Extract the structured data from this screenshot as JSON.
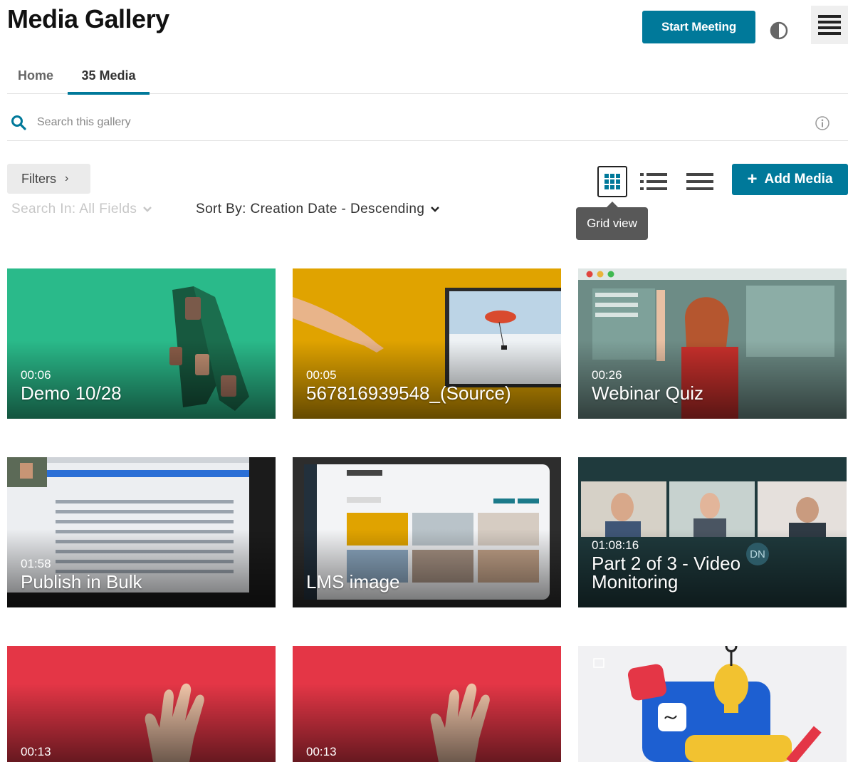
{
  "header": {
    "title": "Media Gallery",
    "start_meeting_label": "Start Meeting"
  },
  "tabs": [
    {
      "label": "Home",
      "active": false
    },
    {
      "label": "35 Media",
      "active": true
    }
  ],
  "search": {
    "placeholder": "Search this gallery",
    "value": ""
  },
  "toolbar": {
    "filters_label": "Filters",
    "search_in_label": "Search In: All Fields",
    "sort_by_label": "Sort By: Creation Date - Descending",
    "add_media_label": "Add Media",
    "tooltip": "Grid view",
    "active_view": "grid"
  },
  "colors": {
    "accent": "#00799a",
    "card_green": "#2ec18f",
    "card_yellow": "#e0a300",
    "card_red": "#e43646"
  },
  "media": [
    {
      "duration": "00:06",
      "title": "Demo 10/28"
    },
    {
      "duration": "00:05",
      "title": "567816939548_(Source)"
    },
    {
      "duration": "00:26",
      "title": "Webinar Quiz"
    },
    {
      "duration": "01:58",
      "title": "Publish in Bulk"
    },
    {
      "duration": "",
      "title": "LMS image"
    },
    {
      "duration": "01:08:16",
      "title": "Part 2 of 3 - Video Monitoring",
      "badge": "DN"
    },
    {
      "duration": "00:13",
      "title": ""
    },
    {
      "duration": "00:13",
      "title": ""
    },
    {
      "duration": "",
      "title": ""
    }
  ]
}
